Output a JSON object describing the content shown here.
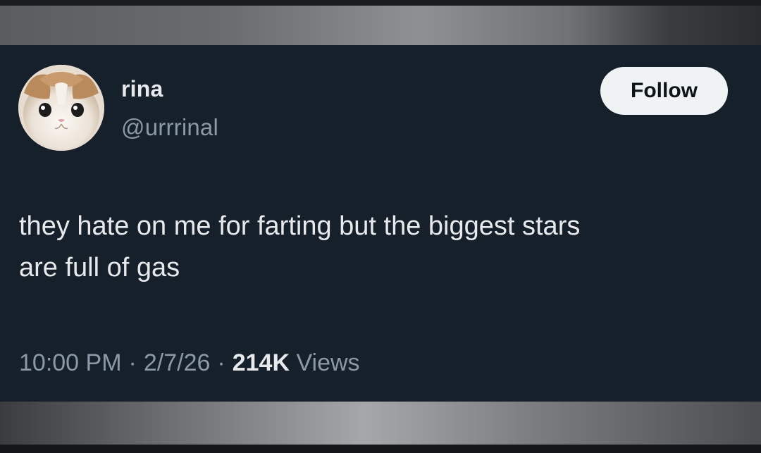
{
  "tweet": {
    "author": {
      "name": "rina",
      "handle": "@urrrinal"
    },
    "follow_label": "Follow",
    "text_lines": [
      "they hate on me for farting but the biggest stars",
      "are full of gas"
    ],
    "meta": {
      "time": "10:00 PM",
      "separator": "·",
      "date": "2/7/26",
      "views_count": "214K",
      "views_label": "Views"
    }
  },
  "colors": {
    "background": "#15202b",
    "primary_text": "#e7e9ea",
    "secondary_text": "#8b98a5",
    "button_bg": "#eff3f4"
  },
  "icons": {
    "avatar": "kitten-avatar"
  }
}
